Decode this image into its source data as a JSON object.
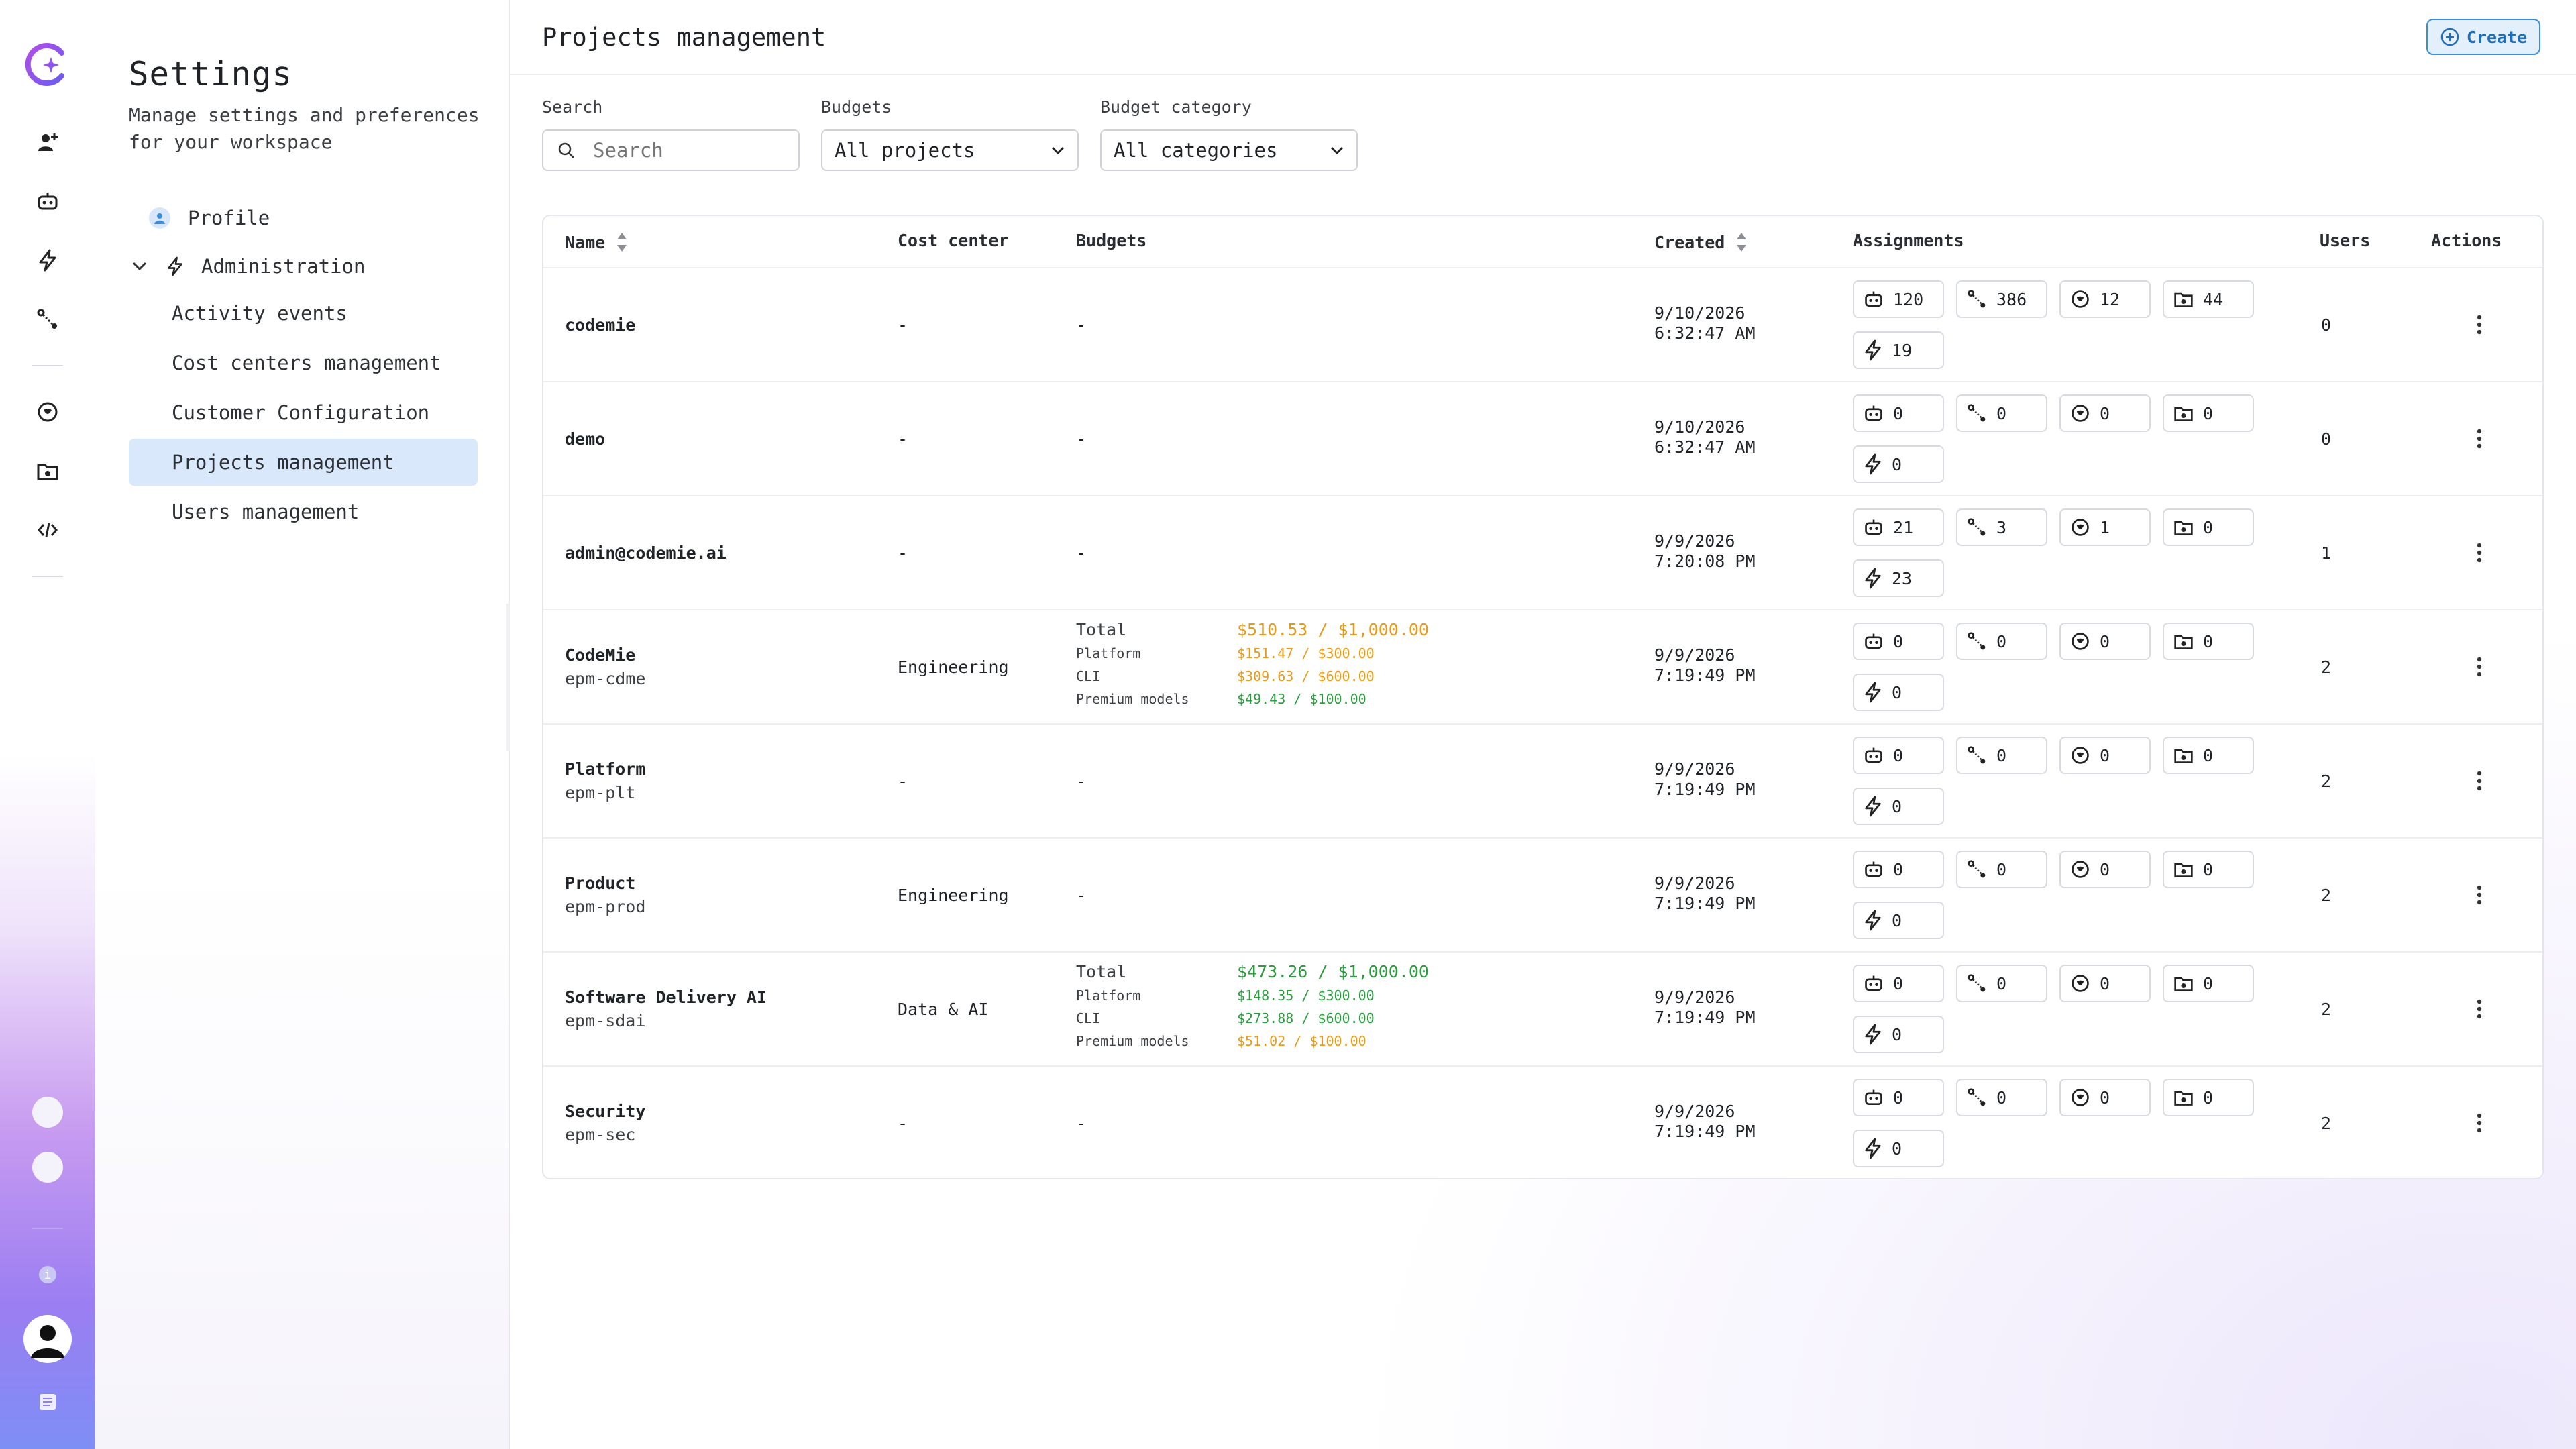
{
  "app": {
    "title": "Settings",
    "subtitle": "Manage settings and preferences for your workspace"
  },
  "rail": {
    "icons": [
      "logo-icon",
      "add-assistant-icon",
      "bot-icon",
      "workflow-icon",
      "integration-icon",
      "marketplace-icon",
      "data-sources-icon",
      "code-icon"
    ],
    "info_label": "i"
  },
  "nav": {
    "profile": "Profile",
    "administration": "Administration",
    "items": [
      {
        "label": "Activity events"
      },
      {
        "label": "Cost centers management"
      },
      {
        "label": "Customer Configuration"
      },
      {
        "label": "Projects management",
        "active": true
      },
      {
        "label": "Users management"
      }
    ]
  },
  "header": {
    "title": "Projects management",
    "create_label": "Create"
  },
  "filters": {
    "search_label": "Search",
    "search_placeholder": "Search",
    "budgets_label": "Budgets",
    "budgets_value": "All projects",
    "category_label": "Budget category",
    "category_value": "All categories"
  },
  "table": {
    "columns": [
      "Name",
      "Cost center",
      "Budgets",
      "Created",
      "Assignments",
      "Users",
      "Actions"
    ],
    "rows": [
      {
        "name": "codemie",
        "code": "",
        "cost_center": "-",
        "budget_simple": "-",
        "created_date": "9/10/2026",
        "created_time": "6:32:47 AM",
        "assign": [
          "120",
          "386",
          "12",
          "44",
          "19"
        ],
        "users": "0"
      },
      {
        "name": "demo",
        "code": "",
        "cost_center": "-",
        "budget_simple": "-",
        "created_date": "9/10/2026",
        "created_time": "6:32:47 AM",
        "assign": [
          "0",
          "0",
          "0",
          "0",
          "0"
        ],
        "users": "0"
      },
      {
        "name": "admin@codemie.ai",
        "code": "",
        "cost_center": "-",
        "budget_simple": "-",
        "created_date": "9/9/2026",
        "created_time": "7:20:08 PM",
        "assign": [
          "21",
          "3",
          "1",
          "0",
          "23"
        ],
        "users": "1"
      },
      {
        "name": "CodeMie",
        "code": "epm-cdme",
        "cost_center": "Engineering",
        "budget_simple": "",
        "budget": {
          "total_label": "Total",
          "total": "$510.53 / $1,000.00",
          "total_color": "orange",
          "lines": [
            {
              "label": "Platform",
              "value": "$151.47 / $300.00",
              "color": "orange"
            },
            {
              "label": "CLI",
              "value": "$309.63 / $600.00",
              "color": "orange"
            },
            {
              "label": "Premium models",
              "value": "$49.43 / $100.00",
              "color": "green"
            }
          ]
        },
        "created_date": "9/9/2026",
        "created_time": "7:19:49 PM",
        "assign": [
          "0",
          "0",
          "0",
          "0",
          "0"
        ],
        "users": "2"
      },
      {
        "name": "Platform",
        "code": "epm-plt",
        "cost_center": "-",
        "budget_simple": "-",
        "created_date": "9/9/2026",
        "created_time": "7:19:49 PM",
        "assign": [
          "0",
          "0",
          "0",
          "0",
          "0"
        ],
        "users": "2"
      },
      {
        "name": "Product",
        "code": "epm-prod",
        "cost_center": "Engineering",
        "budget_simple": "-",
        "created_date": "9/9/2026",
        "created_time": "7:19:49 PM",
        "assign": [
          "0",
          "0",
          "0",
          "0",
          "0"
        ],
        "users": "2"
      },
      {
        "name": "Software Delivery AI",
        "code": "epm-sdai",
        "cost_center": "Data & AI",
        "budget_simple": "",
        "budget": {
          "total_label": "Total",
          "total": "$473.26 / $1,000.00",
          "total_color": "green",
          "lines": [
            {
              "label": "Platform",
              "value": "$148.35 / $300.00",
              "color": "green"
            },
            {
              "label": "CLI",
              "value": "$273.88 / $600.00",
              "color": "green"
            },
            {
              "label": "Premium models",
              "value": "$51.02 / $100.00",
              "color": "orange"
            }
          ]
        },
        "created_date": "9/9/2026",
        "created_time": "7:19:49 PM",
        "assign": [
          "0",
          "0",
          "0",
          "0",
          "0"
        ],
        "users": "2"
      },
      {
        "name": "Security",
        "code": "epm-sec",
        "cost_center": "-",
        "budget_simple": "-",
        "created_date": "9/9/2026",
        "created_time": "7:19:49 PM",
        "assign": [
          "0",
          "0",
          "0",
          "0",
          "0"
        ],
        "users": "2"
      }
    ]
  },
  "colors": {
    "accent": "#3a8fd8",
    "active_nav": "#d9e8fb",
    "orange": "#e69a1a",
    "green": "#2c9a3f"
  }
}
